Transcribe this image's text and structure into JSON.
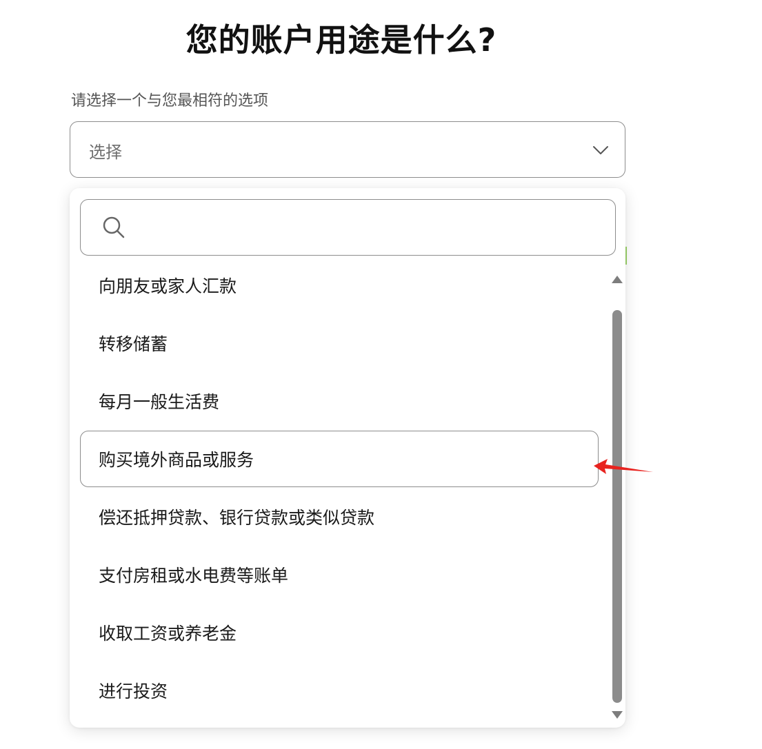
{
  "page": {
    "title": "您的账户用途是什么?",
    "prompt_label": "请选择一个与您最相符的选项"
  },
  "select": {
    "placeholder": "选择",
    "icon": "chevron-down-icon"
  },
  "search": {
    "icon": "search-icon",
    "value": ""
  },
  "options": [
    {
      "label": "向朋友或家人汇款",
      "highlighted": false
    },
    {
      "label": "转移储蓄",
      "highlighted": false
    },
    {
      "label": "每月一般生活费",
      "highlighted": false
    },
    {
      "label": "购买境外商品或服务",
      "highlighted": true
    },
    {
      "label": "偿还抵押贷款、银行贷款或类似贷款",
      "highlighted": false
    },
    {
      "label": "支付房租或水电费等账单",
      "highlighted": false
    },
    {
      "label": "收取工资或养老金",
      "highlighted": false
    },
    {
      "label": "进行投资",
      "highlighted": false
    }
  ],
  "colors": {
    "border": "#8c8c8c",
    "scrollbar": "#8c8c8c",
    "annotation_arrow": "#e8231f"
  }
}
